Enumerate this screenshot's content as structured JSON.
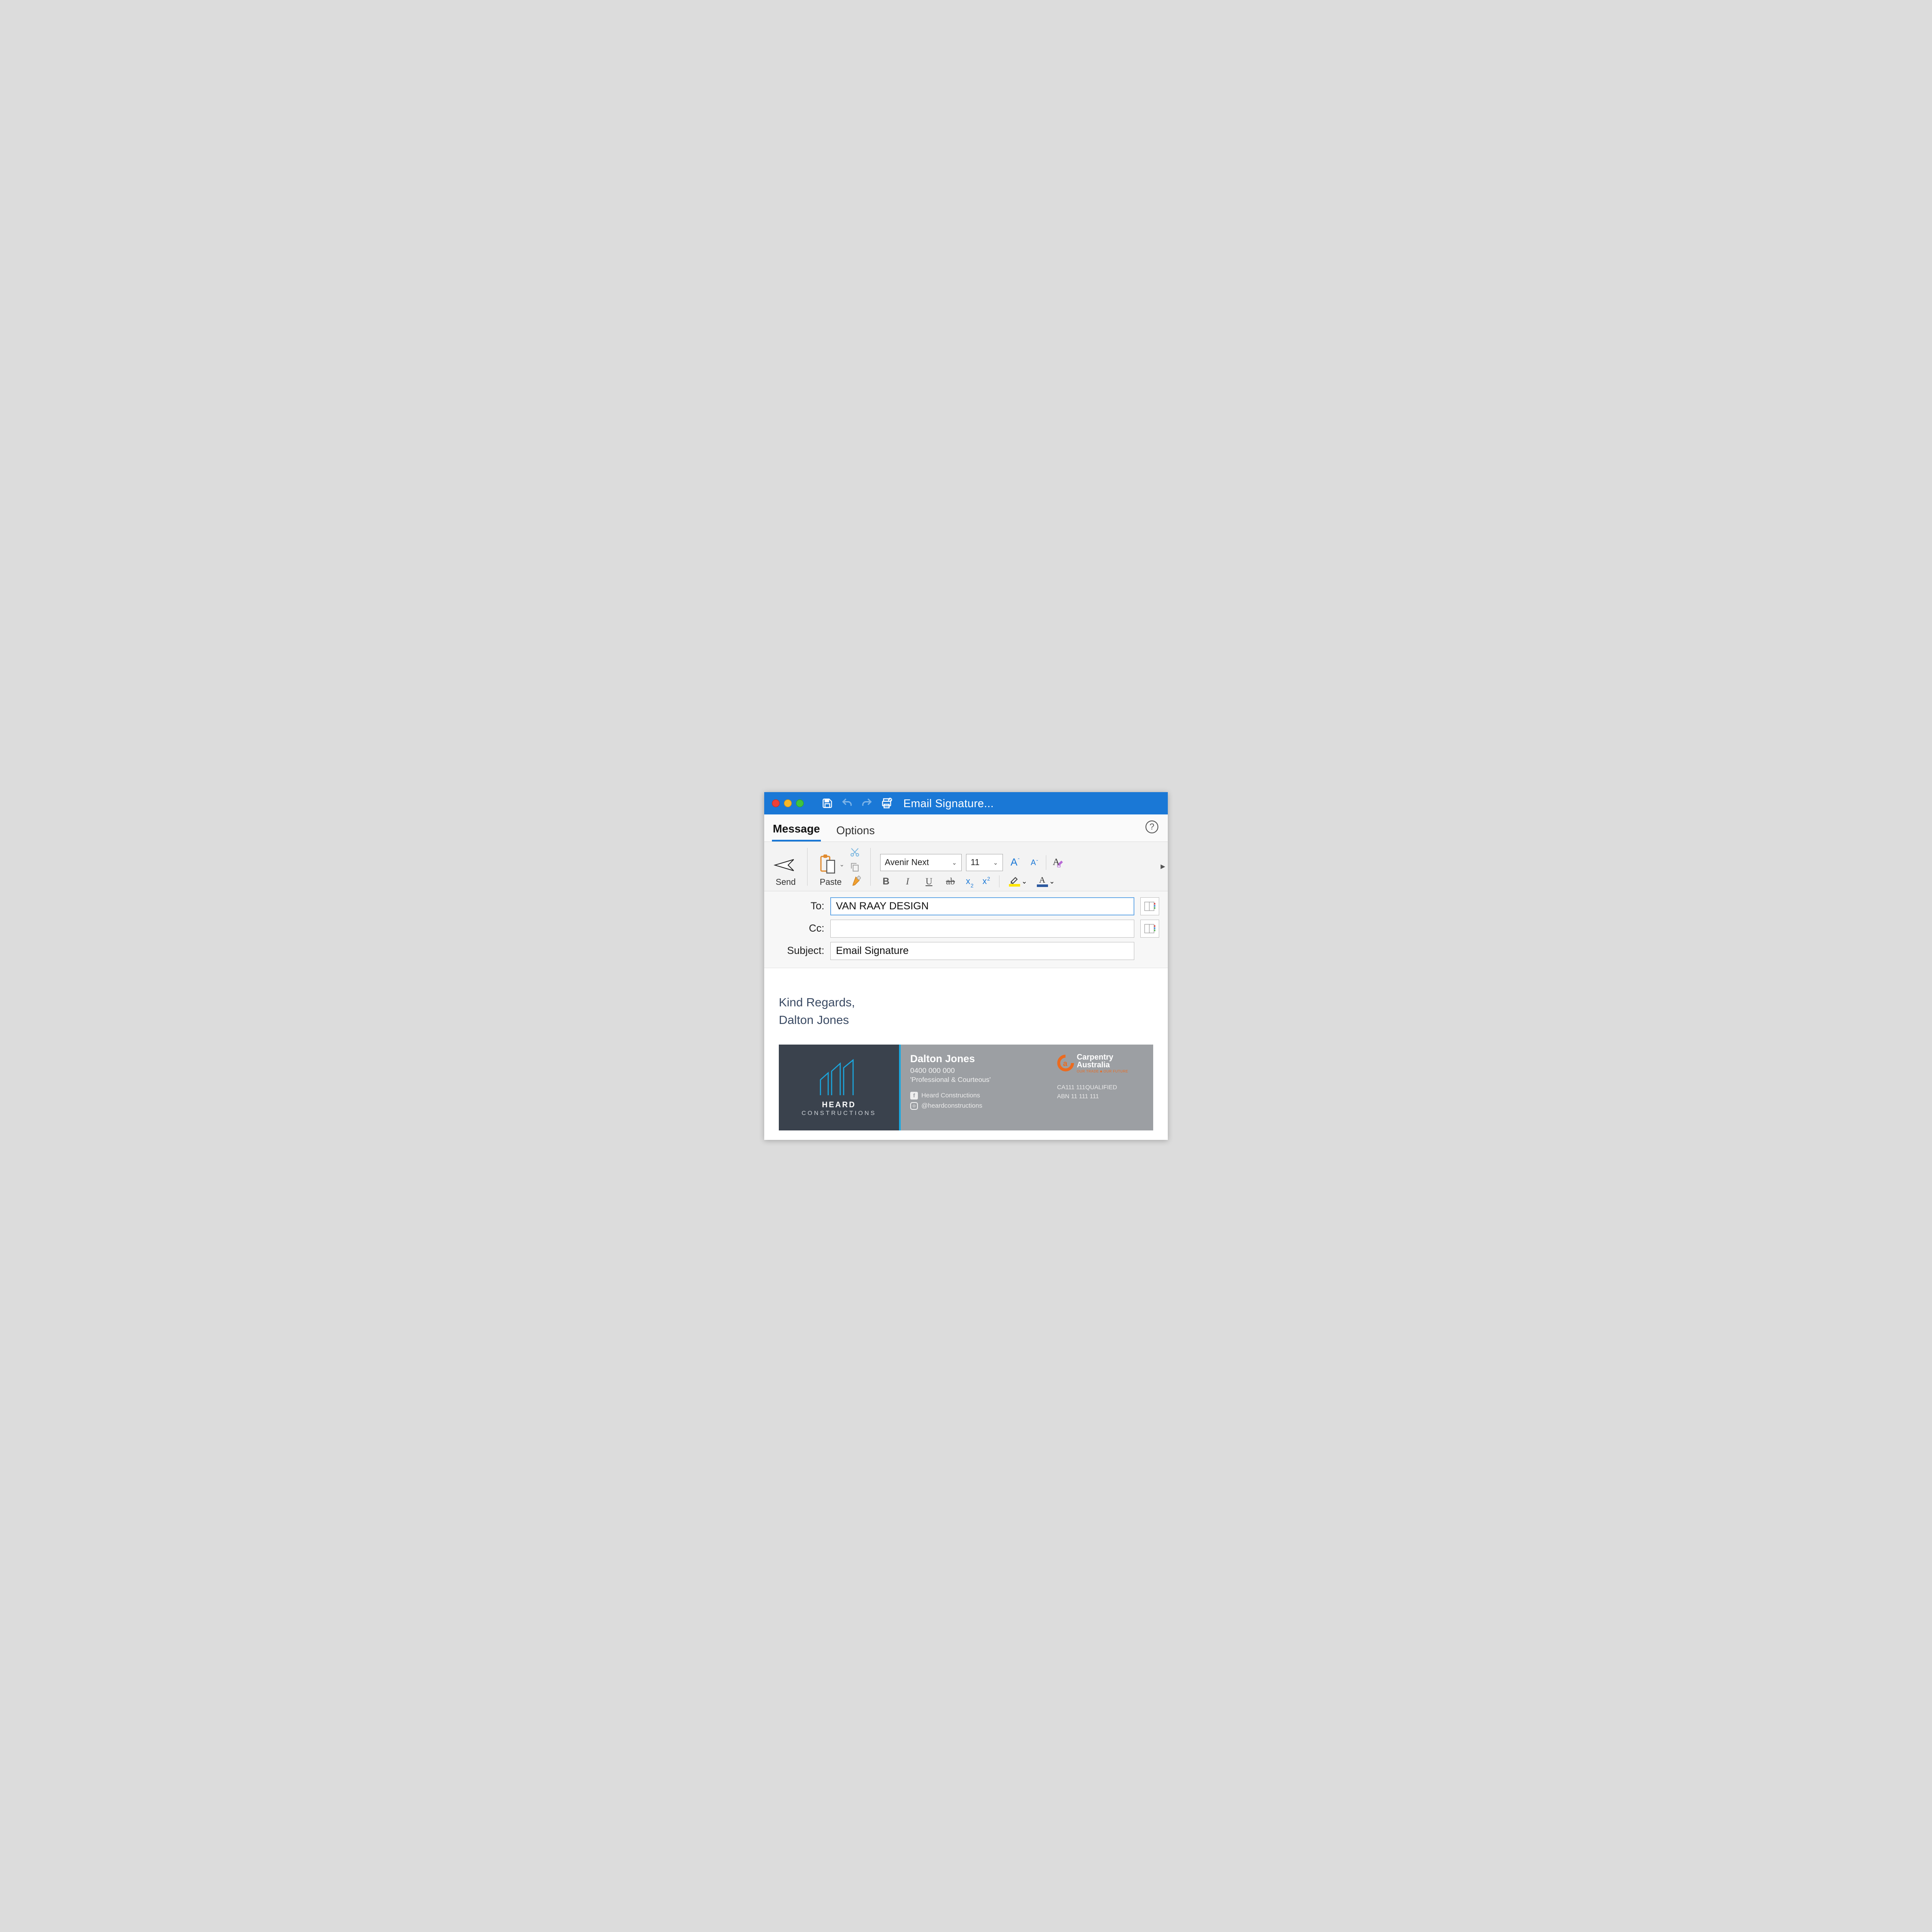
{
  "window": {
    "title": "Email Signature..."
  },
  "tabs": {
    "message": "Message",
    "options": "Options"
  },
  "ribbon": {
    "send": "Send",
    "paste": "Paste",
    "font_name": "Avenir Next",
    "font_size": "11"
  },
  "fields": {
    "to_label": "To:",
    "to_value": "VAN RAAY DESIGN",
    "cc_label": "Cc:",
    "cc_value": "",
    "subject_label": "Subject:",
    "subject_value": "Email Signature"
  },
  "body": {
    "line1": "Kind Regards,",
    "line2": "Dalton Jones"
  },
  "signature": {
    "brand_top": "HEARD",
    "brand_bottom": "CONSTRUCTIONS",
    "name": "Dalton Jones",
    "phone": "0400 000 000",
    "tagline": "'Professional & Courteous'",
    "fb": "Heard Constructions",
    "ig": "@heardconstructions",
    "ca_line1": "Carpentry",
    "ca_line2": "Australia",
    "ca_tag": "OUR TRADE ■ OUR FUTURE",
    "qual": "CA111 111QUALIFIED",
    "abn": "ABN 11 111 111"
  }
}
